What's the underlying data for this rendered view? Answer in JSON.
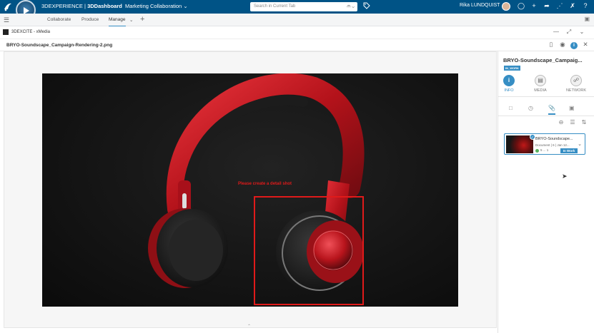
{
  "topbar": {
    "brand_light": "3DEXPERIENCE",
    "brand_sep": " | ",
    "brand_bold": "3DDashboard",
    "dashboard_name": "Marketing Collaboration",
    "search_placeholder": "Search in Current Tab",
    "user_name": "Rika LUNDQUIST"
  },
  "tabs": [
    {
      "label": "Collaborate"
    },
    {
      "label": "Produce"
    },
    {
      "label": "Manage",
      "active": true
    }
  ],
  "widget": {
    "title": "3DEXCITE - xMedia"
  },
  "file": {
    "name": "BRYO-Soundscape_Campaign-Rendering-2.png"
  },
  "annotation": {
    "text": "Please create a detail shot"
  },
  "right_panel": {
    "title": "BRYO-Soundscape_Campaig...",
    "badge": "IN_WORK",
    "tabs": [
      "INFO",
      "MEDIA",
      "NETWORK"
    ],
    "card": {
      "title": "BRYO-Soundscape...",
      "meta": "Document | 6 | Jan 12...",
      "version": "5 ... 1",
      "status": "In Work"
    }
  },
  "colors": {
    "topbar_bg": "#005386",
    "accent": "#368ec4",
    "annotation": "#e01a1a",
    "product_red": "#c8141c"
  }
}
